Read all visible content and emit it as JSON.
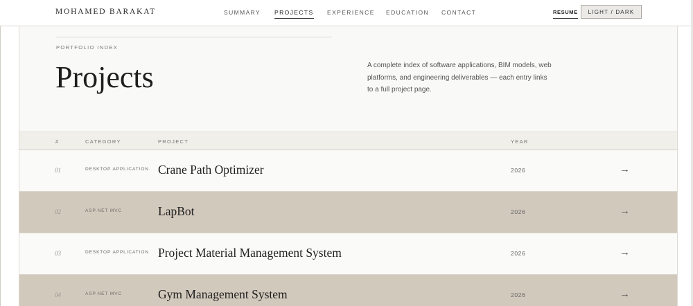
{
  "header": {
    "brand": "MOHAMED BARAKAT",
    "nav": [
      {
        "label": "SUMMARY",
        "active": false
      },
      {
        "label": "PROJECTS",
        "active": true
      },
      {
        "label": "EXPERIENCE",
        "active": false
      },
      {
        "label": "EDUCATION",
        "active": false
      },
      {
        "label": "CONTACT",
        "active": false
      }
    ],
    "resume_label": "RESUME",
    "theme_toggle_label": "LIGHT / DARK"
  },
  "hero": {
    "eyebrow": "PORTFOLIO INDEX",
    "title": "Projects",
    "intro": "A complete index of software applications, BIM models, web platforms, and engineering deliverables — each entry links to a full project page."
  },
  "table": {
    "headers": {
      "number": "#",
      "category": "CATEGORY",
      "project": "PROJECT",
      "year": "YEAR"
    },
    "rows": [
      {
        "number": "01",
        "category": "DESKTOP APPLICATION",
        "project": "Crane Path Optimizer",
        "year": "2026",
        "arrow": "→"
      },
      {
        "number": "02",
        "category": "ASP.NET MVC",
        "project": "LapBot",
        "year": "2026",
        "arrow": "→"
      },
      {
        "number": "03",
        "category": "DESKTOP APPLICATION",
        "project": "Project Material Management System",
        "year": "2026",
        "arrow": "→"
      },
      {
        "number": "04",
        "category": "ASP.NET MVC",
        "project": "Gym Management System",
        "year": "2026",
        "arrow": "→"
      }
    ]
  },
  "colors": {
    "page_background": "#f9f9f7",
    "table_header_background": "#f1efea",
    "highlight_row_background": "#d2c9bd",
    "text_primary": "#1e1e1e",
    "text_muted": "#777777"
  }
}
